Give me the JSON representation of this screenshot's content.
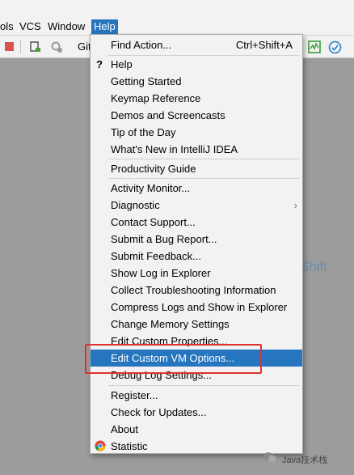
{
  "menubar": {
    "items": [
      "ols",
      "VCS",
      "Window",
      "Help"
    ]
  },
  "toolbar": {
    "git_label": "Git"
  },
  "background": {
    "ghost_text": "Shift"
  },
  "help_menu": {
    "items": [
      {
        "label": "Find Action...",
        "shortcut": "Ctrl+Shift+A"
      },
      {
        "label": "Help",
        "icon": "?"
      },
      {
        "label": "Getting Started"
      },
      {
        "label": "Keymap Reference"
      },
      {
        "label": "Demos and Screencasts"
      },
      {
        "label": "Tip of the Day"
      },
      {
        "label": "What's New in IntelliJ IDEA"
      },
      {
        "label": "Productivity Guide"
      },
      {
        "label": "Activity Monitor..."
      },
      {
        "label": "Diagnostic",
        "arrow": "›"
      },
      {
        "label": "Contact Support..."
      },
      {
        "label": "Submit a Bug Report..."
      },
      {
        "label": "Submit Feedback..."
      },
      {
        "label": "Show Log in Explorer"
      },
      {
        "label": "Collect Troubleshooting Information"
      },
      {
        "label": "Compress Logs and Show in Explorer"
      },
      {
        "label": "Change Memory Settings"
      },
      {
        "label": "Edit Custom Properties..."
      },
      {
        "label": "Edit Custom VM Options..."
      },
      {
        "label": "Debug Log Settings..."
      },
      {
        "label": "Register..."
      },
      {
        "label": "Check for Updates..."
      },
      {
        "label": "About"
      },
      {
        "label": "Statistic"
      }
    ]
  },
  "watermark": "Java技术栈",
  "colors": {
    "selection": "#2675bf",
    "highlight_border": "#e03030"
  }
}
